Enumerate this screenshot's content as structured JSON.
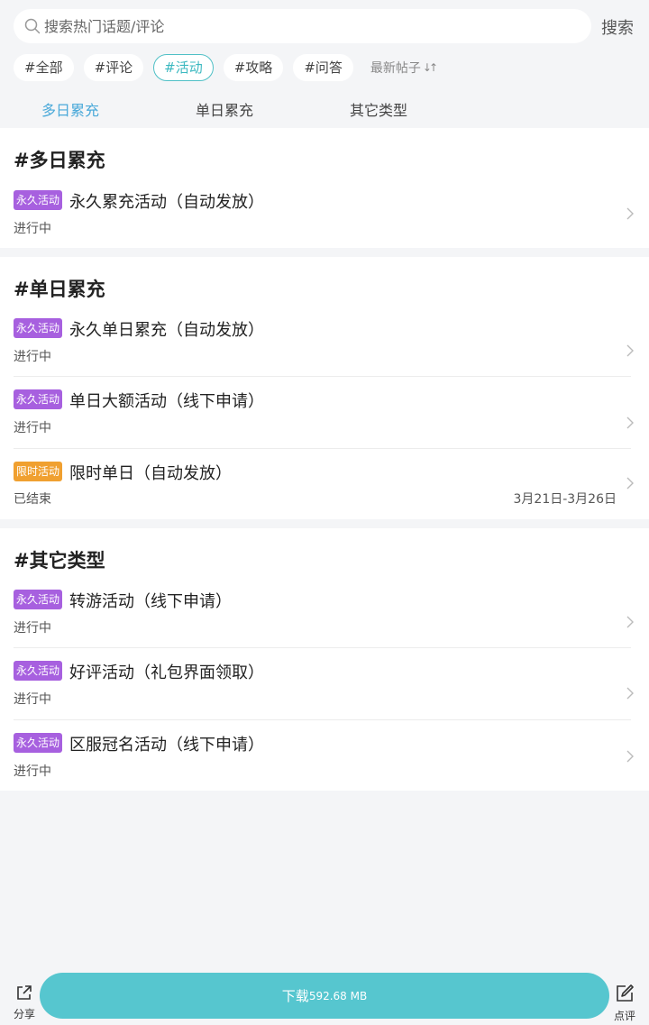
{
  "search": {
    "placeholder": "搜索热门话题/评论",
    "button": "搜索"
  },
  "chips": [
    "#全部",
    "#评论",
    "#活动",
    "#攻略",
    "#问答"
  ],
  "sort_label": "最新帖子",
  "tabs": [
    "多日累充",
    "单日累充",
    "其它类型"
  ],
  "sections": [
    {
      "title": "#多日累充",
      "items": [
        {
          "badge": "永久活动",
          "title": "永久累充活动（自动发放）",
          "status": "进行中",
          "date": ""
        }
      ]
    },
    {
      "title": "#单日累充",
      "items": [
        {
          "badge": "永久活动",
          "title": "永久单日累充（自动发放）",
          "status": "进行中",
          "date": ""
        },
        {
          "badge": "永久活动",
          "title": "单日大额活动（线下申请）",
          "status": "进行中",
          "date": ""
        },
        {
          "badge": "限时活动",
          "title": "限时单日（自动发放）",
          "status": "已结束",
          "date": "3月21日-3月26日"
        }
      ]
    },
    {
      "title": "#其它类型",
      "items": [
        {
          "badge": "永久活动",
          "title": "转游活动（线下申请）",
          "status": "进行中",
          "date": ""
        },
        {
          "badge": "永久活动",
          "title": "好评活动（礼包界面领取）",
          "status": "进行中",
          "date": ""
        },
        {
          "badge": "永久活动",
          "title": "区服冠名活动（线下申请）",
          "status": "进行中",
          "date": ""
        }
      ]
    }
  ],
  "bottom": {
    "share": "分享",
    "download": "下载",
    "size": "592.68 MB",
    "rate": "点评"
  },
  "colors": {
    "accent": "#56c6cf",
    "active_tab": "#4aa9d9",
    "badge_permanent": "#a760df",
    "badge_limited": "#f0a030"
  }
}
